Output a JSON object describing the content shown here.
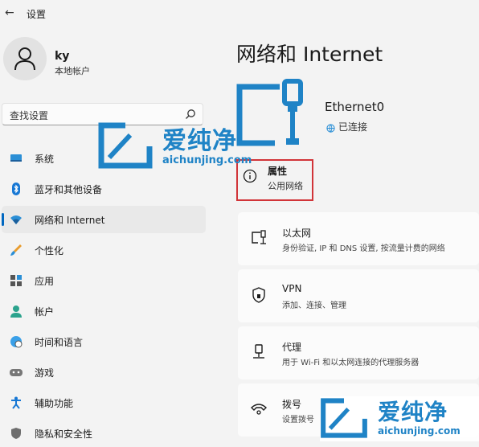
{
  "window": {
    "title": "设置"
  },
  "account": {
    "name": "ky",
    "type": "本地帐户"
  },
  "search": {
    "placeholder": "查找设置"
  },
  "sidebar": {
    "items": [
      {
        "label": "系统",
        "icon": "system-icon"
      },
      {
        "label": "蓝牙和其他设备",
        "icon": "bluetooth-icon"
      },
      {
        "label": "网络和 Internet",
        "icon": "wifi-icon",
        "selected": true
      },
      {
        "label": "个性化",
        "icon": "brush-icon"
      },
      {
        "label": "应用",
        "icon": "apps-icon"
      },
      {
        "label": "帐户",
        "icon": "person-icon"
      },
      {
        "label": "时间和语言",
        "icon": "globe-clock-icon"
      },
      {
        "label": "游戏",
        "icon": "gamepad-icon"
      },
      {
        "label": "辅助功能",
        "icon": "accessibility-icon"
      },
      {
        "label": "隐私和安全性",
        "icon": "shield-icon"
      }
    ]
  },
  "main": {
    "title": "网络和 Internet",
    "adapter": {
      "name": "Ethernet0",
      "status": "已连接"
    },
    "properties": {
      "title": "属性",
      "subtitle": "公用网络"
    },
    "cards": [
      {
        "title": "以太网",
        "subtitle": "身份验证, IP 和 DNS 设置, 按流量计费的网络",
        "icon": "ethernet-icon"
      },
      {
        "title": "VPN",
        "subtitle": "添加、连接、管理",
        "icon": "vpn-shield-icon"
      },
      {
        "title": "代理",
        "subtitle": "用于 Wi-Fi 和以太网连接的代理服务器",
        "icon": "proxy-icon"
      },
      {
        "title": "拨号",
        "subtitle": "设置拨号",
        "icon": "dialup-icon"
      }
    ]
  },
  "watermark": {
    "text": "爱纯净",
    "url": "aichunjing.com"
  },
  "colors": {
    "accent": "#0067c0",
    "highlight_box": "#d13438",
    "watermark": "#1f83c6"
  }
}
